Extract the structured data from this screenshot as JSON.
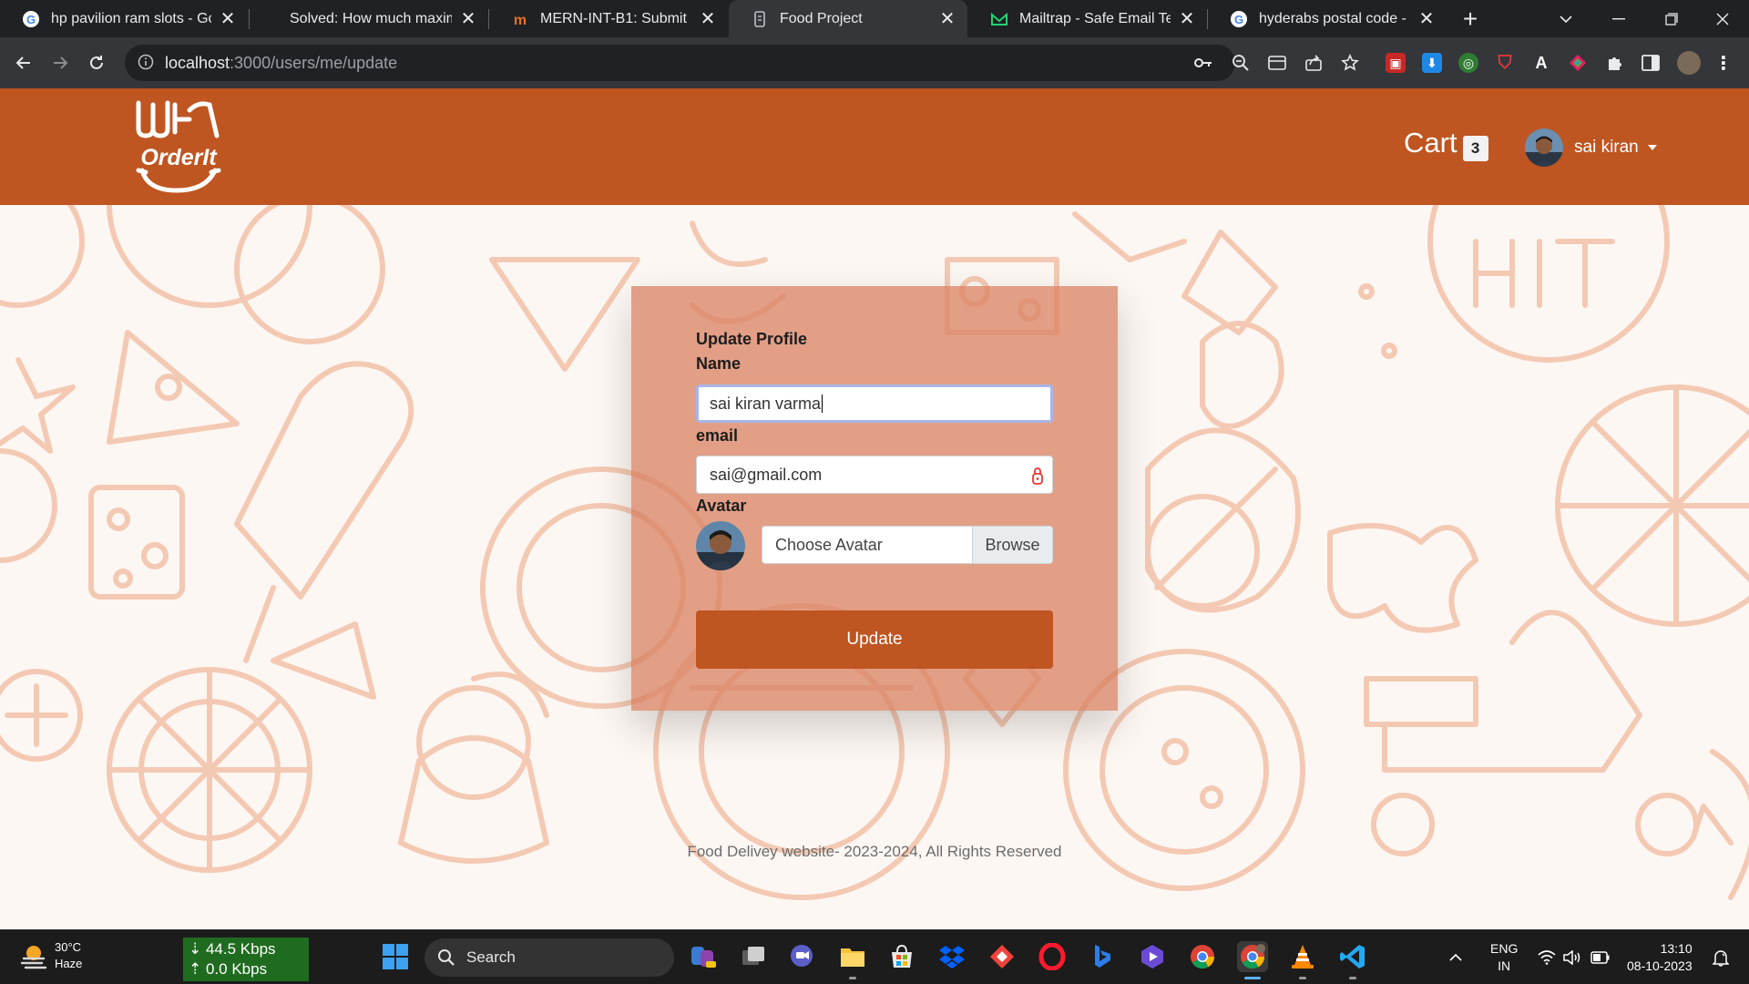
{
  "browser": {
    "tabs": [
      {
        "title": "hp pavilion ram slots - Goo",
        "icon": "google-icon"
      },
      {
        "title": "Solved: How much maximu",
        "icon": "hp-icon"
      },
      {
        "title": "MERN-INT-B1: Submit Ora",
        "icon": "masai-icon"
      },
      {
        "title": "Food Project",
        "icon": "page-icon"
      },
      {
        "title": "Mailtrap - Safe Email Testin",
        "icon": "mailtrap-icon"
      },
      {
        "title": "hyderabs postal code - Goo",
        "icon": "google-icon"
      }
    ],
    "url_host": "localhost",
    "url_path": ":3000/users/me/update"
  },
  "header": {
    "logo_text": "OrderIt",
    "cart_label": "Cart",
    "cart_count": "3",
    "user_name": "sai kiran"
  },
  "form": {
    "title": "Update Profile",
    "name_label": "Name",
    "name_value": "sai kiran varma",
    "email_label": "email",
    "email_value": "sai@gmail.com",
    "avatar_label": "Avatar",
    "file_placeholder": "Choose Avatar",
    "browse_label": "Browse",
    "submit_label": "Update"
  },
  "footer": {
    "text": "Food Delivey website- 2023-2024, All Rights Reserved"
  },
  "taskbar": {
    "temperature": "30°C",
    "weather": "Haze",
    "download_speed": "44.5 Kbps",
    "upload_speed": "0.0 Kbps",
    "search_label": "Search",
    "lang_line1": "ENG",
    "lang_line2": "IN",
    "time": "13:10",
    "date": "08-10-2023"
  },
  "colors": {
    "brand": "#bf5521",
    "card": "#d17452",
    "pattern": "#f4c9b3"
  }
}
